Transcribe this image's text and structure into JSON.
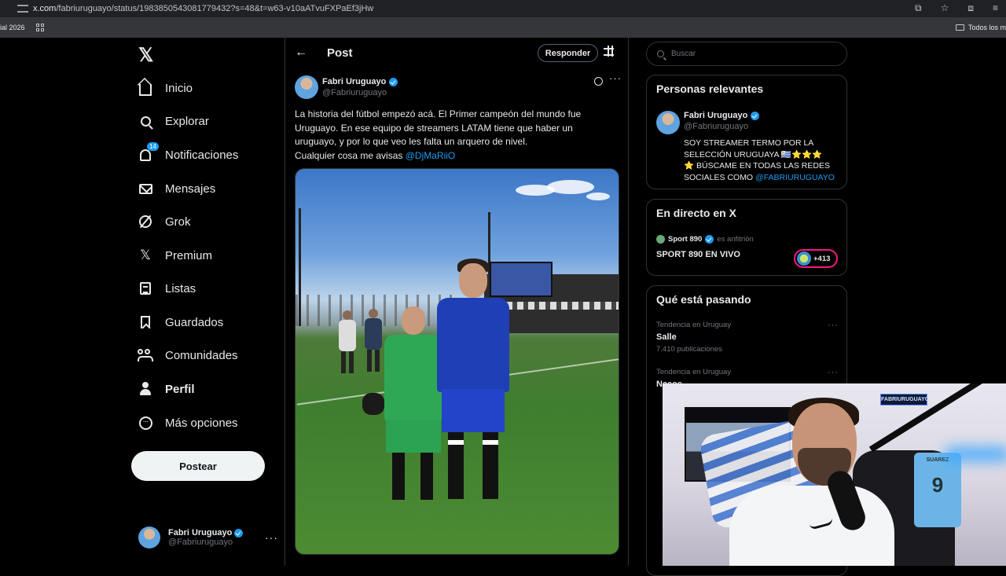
{
  "browser": {
    "url_host": "x.com",
    "url_path": "/fabriuruguayo/status/1983850543081779432?s=48&t=w63-v10aATvuFXPaEf3jHw",
    "bookmark_left": "ial 2026",
    "bookmark_right": "Todos los m"
  },
  "nav": {
    "items": [
      {
        "label": "Inicio"
      },
      {
        "label": "Explorar"
      },
      {
        "label": "Notificaciones",
        "badge": "14"
      },
      {
        "label": "Mensajes"
      },
      {
        "label": "Grok"
      },
      {
        "label": "Premium"
      },
      {
        "label": "Listas"
      },
      {
        "label": "Guardados"
      },
      {
        "label": "Comunidades"
      },
      {
        "label": "Perfil"
      },
      {
        "label": "Más opciones"
      }
    ],
    "post_button": "Postear",
    "account": {
      "name": "Fabri Uruguayo",
      "handle": "@Fabriuruguayo"
    }
  },
  "post": {
    "header_title": "Post",
    "reply_button": "Responder",
    "author": {
      "name": "Fabri Uruguayo",
      "handle": "@Fabriuruguayo"
    },
    "text_lines": [
      "La historia del fútbol empezó acá. El Primer campeón del mundo fue",
      "Uruguayo. En ese equipo de streamers LATAM tiene que haber un",
      "uruguayo, y por lo que veo les falta un arquero de nivel.",
      "Cualquier cosa me avisas "
    ],
    "mention": "@DjMaRiiO"
  },
  "sidebar": {
    "search_placeholder": "Buscar",
    "relevant": {
      "title": "Personas relevantes",
      "name": "Fabri Uruguayo",
      "handle": "@Fabriuruguayo",
      "bio_lines": [
        "SOY STREAMER TERMO POR LA",
        "SELECCIÓN URUGUAYA 🇺🇾⭐⭐⭐",
        "⭐ BÚSCAME EN TODAS LAS REDES",
        "SOCIALES COMO "
      ],
      "bio_mention": "@FABRIURUGUAYO"
    },
    "live": {
      "title": "En directo en X",
      "host_name": "Sport 890",
      "host_role": "es anfitrión",
      "space_title": "SPORT 890 EN VIVO",
      "listeners": "+413"
    },
    "trends": {
      "title": "Qué está pasando",
      "items": [
        {
          "category": "Tendencia en Uruguay",
          "name": "Salle",
          "count": "7.410 publicaciones"
        },
        {
          "category": "Tendencia en Uruguay",
          "name": "Naeos",
          "count": ""
        }
      ]
    }
  },
  "webcam": {
    "sign": "FABRIURUGUAYO",
    "jersey_name": "SUAREZ",
    "jersey_number": "9"
  }
}
